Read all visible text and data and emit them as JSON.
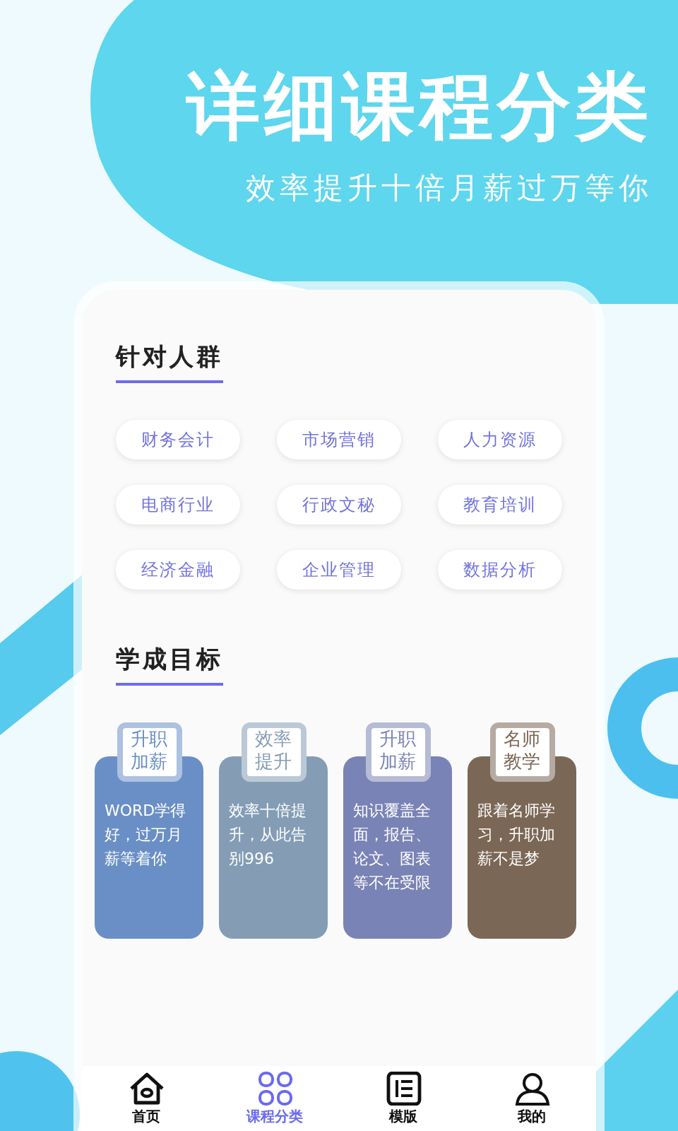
{
  "headline": "详细课程分类",
  "subheadline": "效率提升十倍月薪过万等你",
  "audience": {
    "title": "针对人群",
    "tags": [
      "财务会计",
      "市场营销",
      "人力资源",
      "电商行业",
      "行政文秘",
      "教育培训",
      "经济金融",
      "企业管理",
      "数据分析"
    ]
  },
  "goals": {
    "title": "学成目标",
    "cards": [
      {
        "badge": "升职加薪",
        "text": "WORD学得好，过万月薪等着你",
        "color": "#6a8fc6"
      },
      {
        "badge": "效率提升",
        "text": "效率十倍提升，从此告别996",
        "color": "#849db5"
      },
      {
        "badge": "升职加薪",
        "text": "知识覆盖全面，报告、论文、图表等不在受限",
        "color": "#7a83b5"
      },
      {
        "badge": "名师教学",
        "text": "跟着名师学习，升职加薪不是梦",
        "color": "#7b6755"
      }
    ]
  },
  "tabs": [
    {
      "label": "首页",
      "kind": "home",
      "selected": false
    },
    {
      "label": "课程分类",
      "kind": "grid",
      "selected": true
    },
    {
      "label": "模版",
      "kind": "list",
      "selected": false
    },
    {
      "label": "我的",
      "kind": "user",
      "selected": false
    }
  ]
}
